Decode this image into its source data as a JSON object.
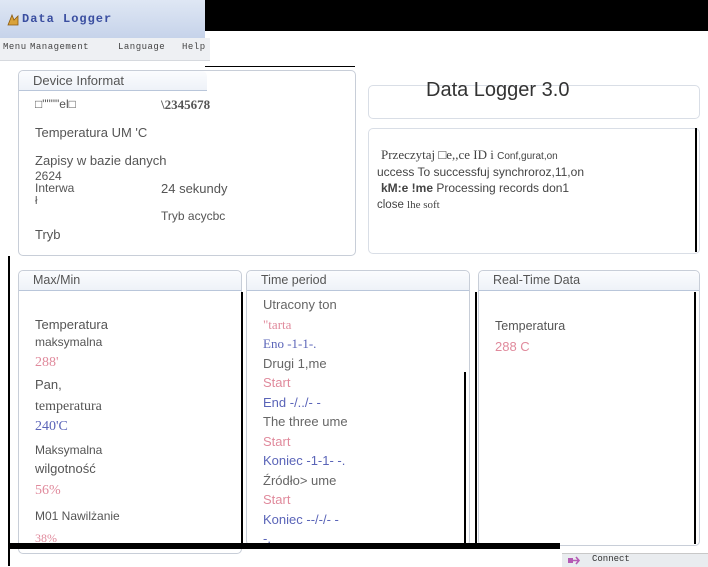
{
  "app": {
    "title": "Data Logger",
    "banner": "Data Logger 3.0"
  },
  "menu": [
    "Menu",
    "Management",
    "Language",
    "Help"
  ],
  "device_info": {
    "title": "Device Informat",
    "row1_left": "□\"\"\"\"el□",
    "row1_right": "\\2345678",
    "temp_unit": "Temperatura UM 'C",
    "records_label": "Zapisy w bazie danych",
    "records_value": "2624",
    "interval_label_a": "Interwa",
    "interval_label_b": "ł",
    "interval_value": "24 sekundy",
    "mode_value": "Tryb acycbc",
    "mode_label": "Tryb"
  },
  "messages": {
    "line1_a": "Przeczytaj □e,,ce ID i ",
    "line1_b": "Conf,gurat,on",
    "line2": "uccess To successfuj synchroroz,11,on",
    "line3_a": "kM:e !me",
    "line3_b": " Processing records don1",
    "line4_a": "close ",
    "line4_b": "lhe soft"
  },
  "maxmin": {
    "title": "Max/Min",
    "max_temp_l1": "Temperatura",
    "max_temp_l2": "maksymalna",
    "max_temp_val": "288'",
    "min_temp_l1": "Pan,",
    "min_temp_l2": "temperatura",
    "min_temp_val": "240'C",
    "max_hum_l1": "Maksymalna",
    "max_hum_l2": "wilgotność",
    "max_hum_val": "56%",
    "min_hum_l1": "M01 Nawilżanie",
    "min_hum_val": "38%"
  },
  "time_period": {
    "title": "Time period",
    "lines": [
      {
        "text": "Utracony ton",
        "cls": "grey"
      },
      {
        "text": "\"tarta",
        "cls": "pink serif"
      },
      {
        "text": "Eno -1-1-.",
        "cls": "blue serif"
      },
      {
        "text": "Drugi 1,me",
        "cls": "grey"
      },
      {
        "text": "Start",
        "cls": "pink"
      },
      {
        "text": "End -/../- -",
        "cls": "blue"
      },
      {
        "text": "The three ume",
        "cls": "grey"
      },
      {
        "text": "Start",
        "cls": "pink"
      },
      {
        "text": "Koniec -1-1- -.",
        "cls": "blue"
      },
      {
        "text": "Źródło> ume",
        "cls": "grey"
      },
      {
        "text": "Start",
        "cls": "pink"
      },
      {
        "text": "Koniec --/-/- -",
        "cls": "blue"
      },
      {
        "text": "-.",
        "cls": "blue"
      }
    ]
  },
  "realtime": {
    "title": "Real-Time Data",
    "temp_label": "Temperatura",
    "temp_value": "288 C"
  },
  "footer": {
    "connect_label": "Connect"
  }
}
